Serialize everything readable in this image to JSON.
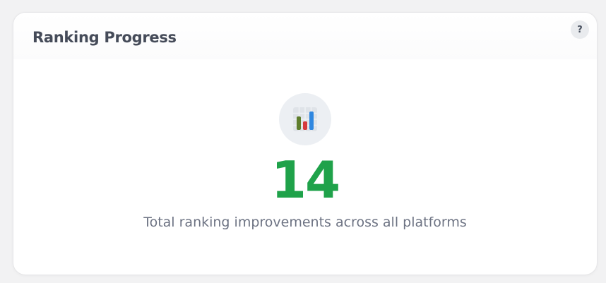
{
  "card": {
    "title": "Ranking Progress",
    "help_label": "?"
  },
  "metric": {
    "icon": "bar-chart-icon",
    "value": "14",
    "caption": "Total ranking improvements across all platforms",
    "value_color": "#1fa24a"
  }
}
